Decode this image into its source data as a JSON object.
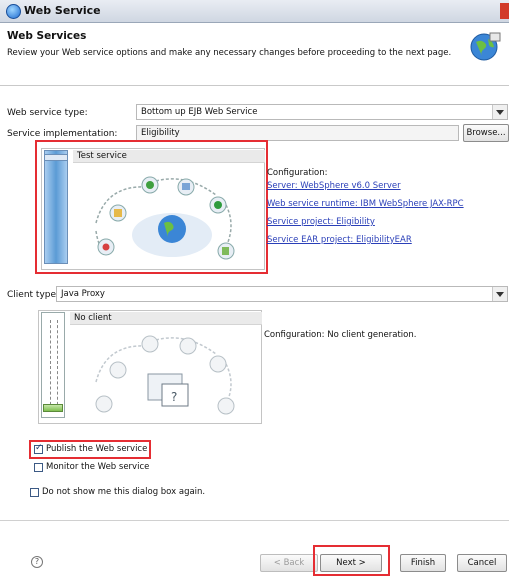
{
  "window": {
    "title": "Web Service"
  },
  "header": {
    "title": "Web Services",
    "description": "Review your Web service options and make any necessary changes before proceeding to the next page."
  },
  "service_type": {
    "label": "Web service type:",
    "value": "Bottom up EJB Web Service"
  },
  "service_impl": {
    "label": "Service implementation:",
    "value": "Eligibility",
    "browse_label": "Browse..."
  },
  "service_panel": {
    "slider_label": "Test service",
    "config_title": "Configuration:",
    "links": [
      "Server: WebSphere v6.0 Server",
      "Web service runtime: IBM WebSphere JAX-RPC",
      "Service project: Eligibility",
      "Service EAR project: EligibilityEAR"
    ]
  },
  "client_type": {
    "label": "Client type:",
    "value": "Java Proxy"
  },
  "client_panel": {
    "slider_label": "No client",
    "config_text": "Configuration: No client generation."
  },
  "options": {
    "publish_label": "Publish the Web service",
    "publish_checked": true,
    "monitor_label": "Monitor the Web service",
    "monitor_checked": false,
    "dont_show_label": "Do not show me this dialog box again.",
    "dont_show_checked": false
  },
  "footer": {
    "help_icon": "help-icon",
    "back_label": "< Back",
    "next_label": "Next >",
    "finish_label": "Finish",
    "cancel_label": "Cancel"
  },
  "colors": {
    "highlight": "#e52d33",
    "link": "#2a3fb8",
    "slider": "#5b9bd5"
  }
}
